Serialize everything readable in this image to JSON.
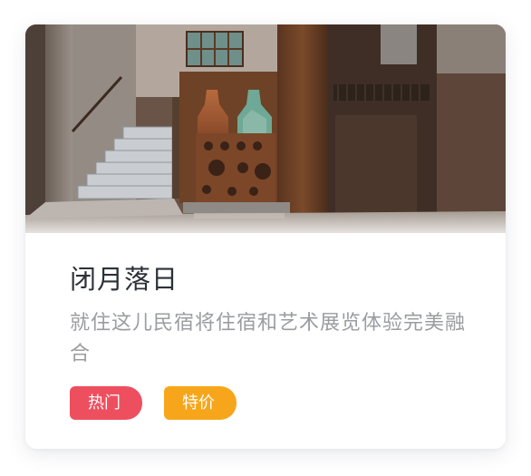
{
  "card": {
    "title": "闭月落日",
    "description": "就住这儿民宿将住宿和艺术展览体验完美融合",
    "tags": [
      {
        "label": "热门",
        "color": "#ee4f5f"
      },
      {
        "label": "特价",
        "color": "#f7a61b"
      }
    ],
    "image": {
      "subject": "industrial-interior-with-rusty-steel-sculpture-and-staircase"
    }
  }
}
